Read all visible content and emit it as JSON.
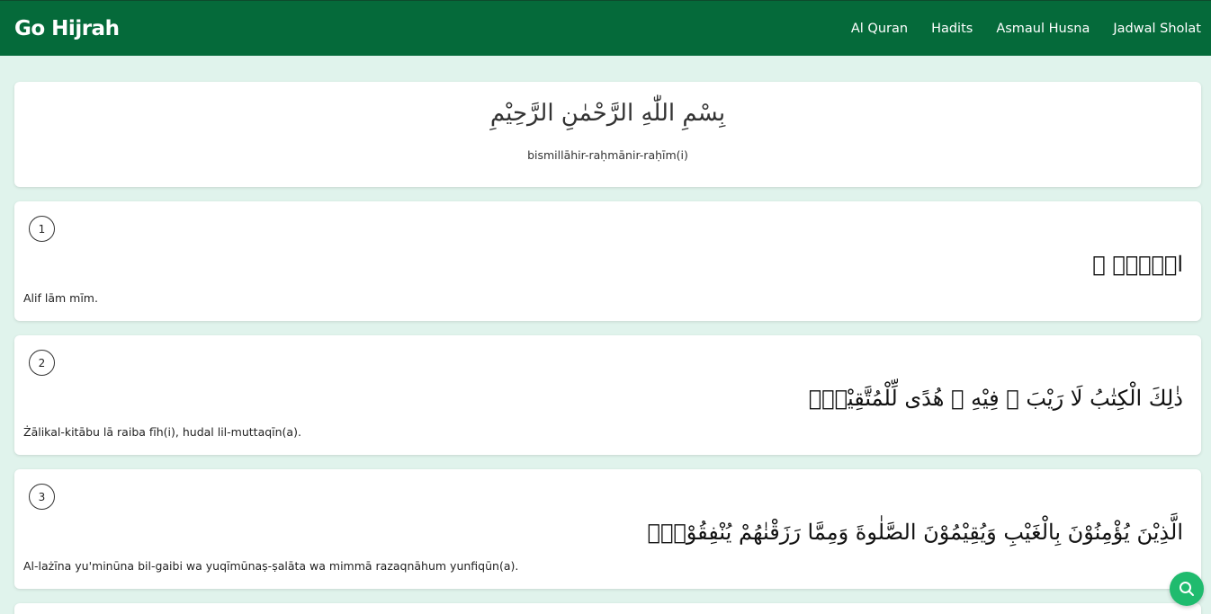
{
  "header": {
    "brand": "Go Hijrah",
    "nav": [
      "Al Quran",
      "Hadits",
      "Asmaul Husna",
      "Jadwal Sholat"
    ]
  },
  "bismillah": {
    "arabic": "بِسْمِ اللّٰهِ الرَّحْمٰنِ الرَّحِيْمِ",
    "latin": "bismillāhir-raḥmānir-raḥīm(i)"
  },
  "verses": [
    {
      "number": "1",
      "arabic": "الۤمّۤ ۚ",
      "latin": "Alif lām mīm."
    },
    {
      "number": "2",
      "arabic": "ذٰلِكَ الْكِتٰبُ لَا رَيْبَ ۛ فِيْهِ ۛ هُدًى لِّلْمُتَّقِيْنَۙ",
      "latin": "Żālikal-kitābu lā raiba fīh(i), hudal lil-muttaqīn(a)."
    },
    {
      "number": "3",
      "arabic": "الَّذِيْنَ يُؤْمِنُوْنَ بِالْغَيْبِ وَيُقِيْمُوْنَ الصَّلٰوةَ وَمِمَّا رَزَقْنٰهُمْ يُنْفِقُوْنَۙ",
      "latin": "Al-lażīna yu'minūna bil-gaibi wa yuqīmūnaṣ-ṣalāta wa mimmā razaqnāhum yunfiqūn(a)."
    }
  ],
  "fab": {
    "icon": "search-icon",
    "color": "#1fbb6e"
  },
  "colors": {
    "header": "#056a3a",
    "background": "#e0f3ec"
  }
}
